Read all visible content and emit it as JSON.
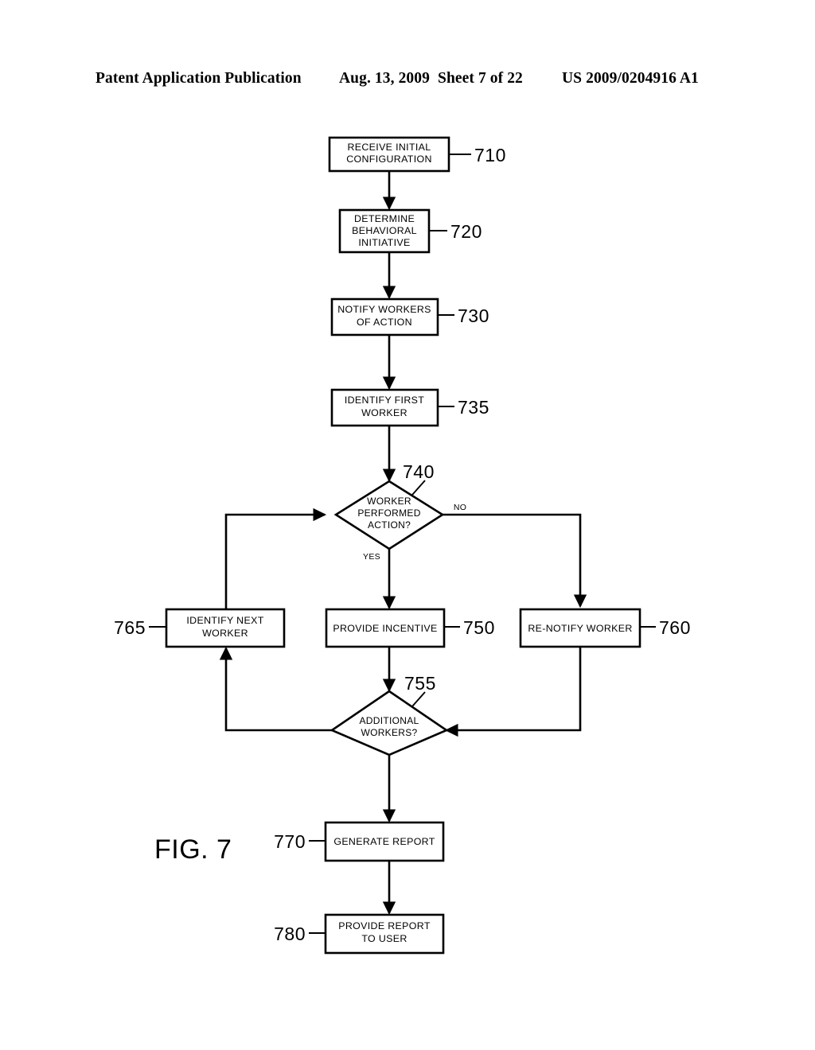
{
  "header": {
    "publication": "Patent Application Publication",
    "date": "Aug. 13, 2009",
    "sheet": "Sheet 7 of 22",
    "patent_number": "US 2009/0204916 A1"
  },
  "figure": {
    "label": "FIG. 7",
    "type": "flowchart"
  },
  "nodes": [
    {
      "id": "710",
      "ref": "710",
      "shape": "rect",
      "lines": [
        "RECEIVE INITIAL",
        "CONFIGURATION"
      ],
      "ref_side": "right"
    },
    {
      "id": "720",
      "ref": "720",
      "shape": "rect",
      "lines": [
        "DETERMINE",
        "BEHAVIORAL",
        "INITIATIVE"
      ],
      "ref_side": "right"
    },
    {
      "id": "730",
      "ref": "730",
      "shape": "rect",
      "lines": [
        "NOTIFY WORKERS",
        "OF ACTION"
      ],
      "ref_side": "right"
    },
    {
      "id": "735",
      "ref": "735",
      "shape": "rect",
      "lines": [
        "IDENTIFY FIRST",
        "WORKER"
      ],
      "ref_side": "right"
    },
    {
      "id": "740",
      "ref": "740",
      "shape": "diamond",
      "lines": [
        "WORKER",
        "PERFORMED",
        "ACTION?"
      ],
      "ref_side": "top-right"
    },
    {
      "id": "765",
      "ref": "765",
      "shape": "rect",
      "lines": [
        "IDENTIFY NEXT",
        "WORKER"
      ],
      "ref_side": "left"
    },
    {
      "id": "750",
      "ref": "750",
      "shape": "rect",
      "lines": [
        "PROVIDE INCENTIVE"
      ],
      "ref_side": "right"
    },
    {
      "id": "760",
      "ref": "760",
      "shape": "rect",
      "lines": [
        "RE-NOTIFY WORKER"
      ],
      "ref_side": "right"
    },
    {
      "id": "755",
      "ref": "755",
      "shape": "diamond",
      "lines": [
        "ADDITIONAL",
        "WORKERS?"
      ],
      "ref_side": "top-right"
    },
    {
      "id": "770",
      "ref": "770",
      "shape": "rect",
      "lines": [
        "GENERATE REPORT"
      ],
      "ref_side": "left"
    },
    {
      "id": "780",
      "ref": "780",
      "shape": "rect",
      "lines": [
        "PROVIDE REPORT",
        "TO USER"
      ],
      "ref_side": "left"
    }
  ],
  "branch_labels": {
    "yes": "YES",
    "no": "NO"
  },
  "edges": [
    {
      "from": "710",
      "to": "720",
      "label": ""
    },
    {
      "from": "720",
      "to": "730",
      "label": ""
    },
    {
      "from": "730",
      "to": "735",
      "label": ""
    },
    {
      "from": "735",
      "to": "740",
      "label": ""
    },
    {
      "from": "740",
      "to": "750",
      "label": "YES"
    },
    {
      "from": "740",
      "to": "760",
      "label": "NO"
    },
    {
      "from": "750",
      "to": "755",
      "label": ""
    },
    {
      "from": "760",
      "to": "755",
      "label": ""
    },
    {
      "from": "755",
      "to": "765",
      "label": ""
    },
    {
      "from": "765",
      "to": "740",
      "label": ""
    },
    {
      "from": "755",
      "to": "770",
      "label": ""
    },
    {
      "from": "770",
      "to": "780",
      "label": ""
    }
  ],
  "colors": {
    "ink": "#000000",
    "paper": "#ffffff"
  }
}
